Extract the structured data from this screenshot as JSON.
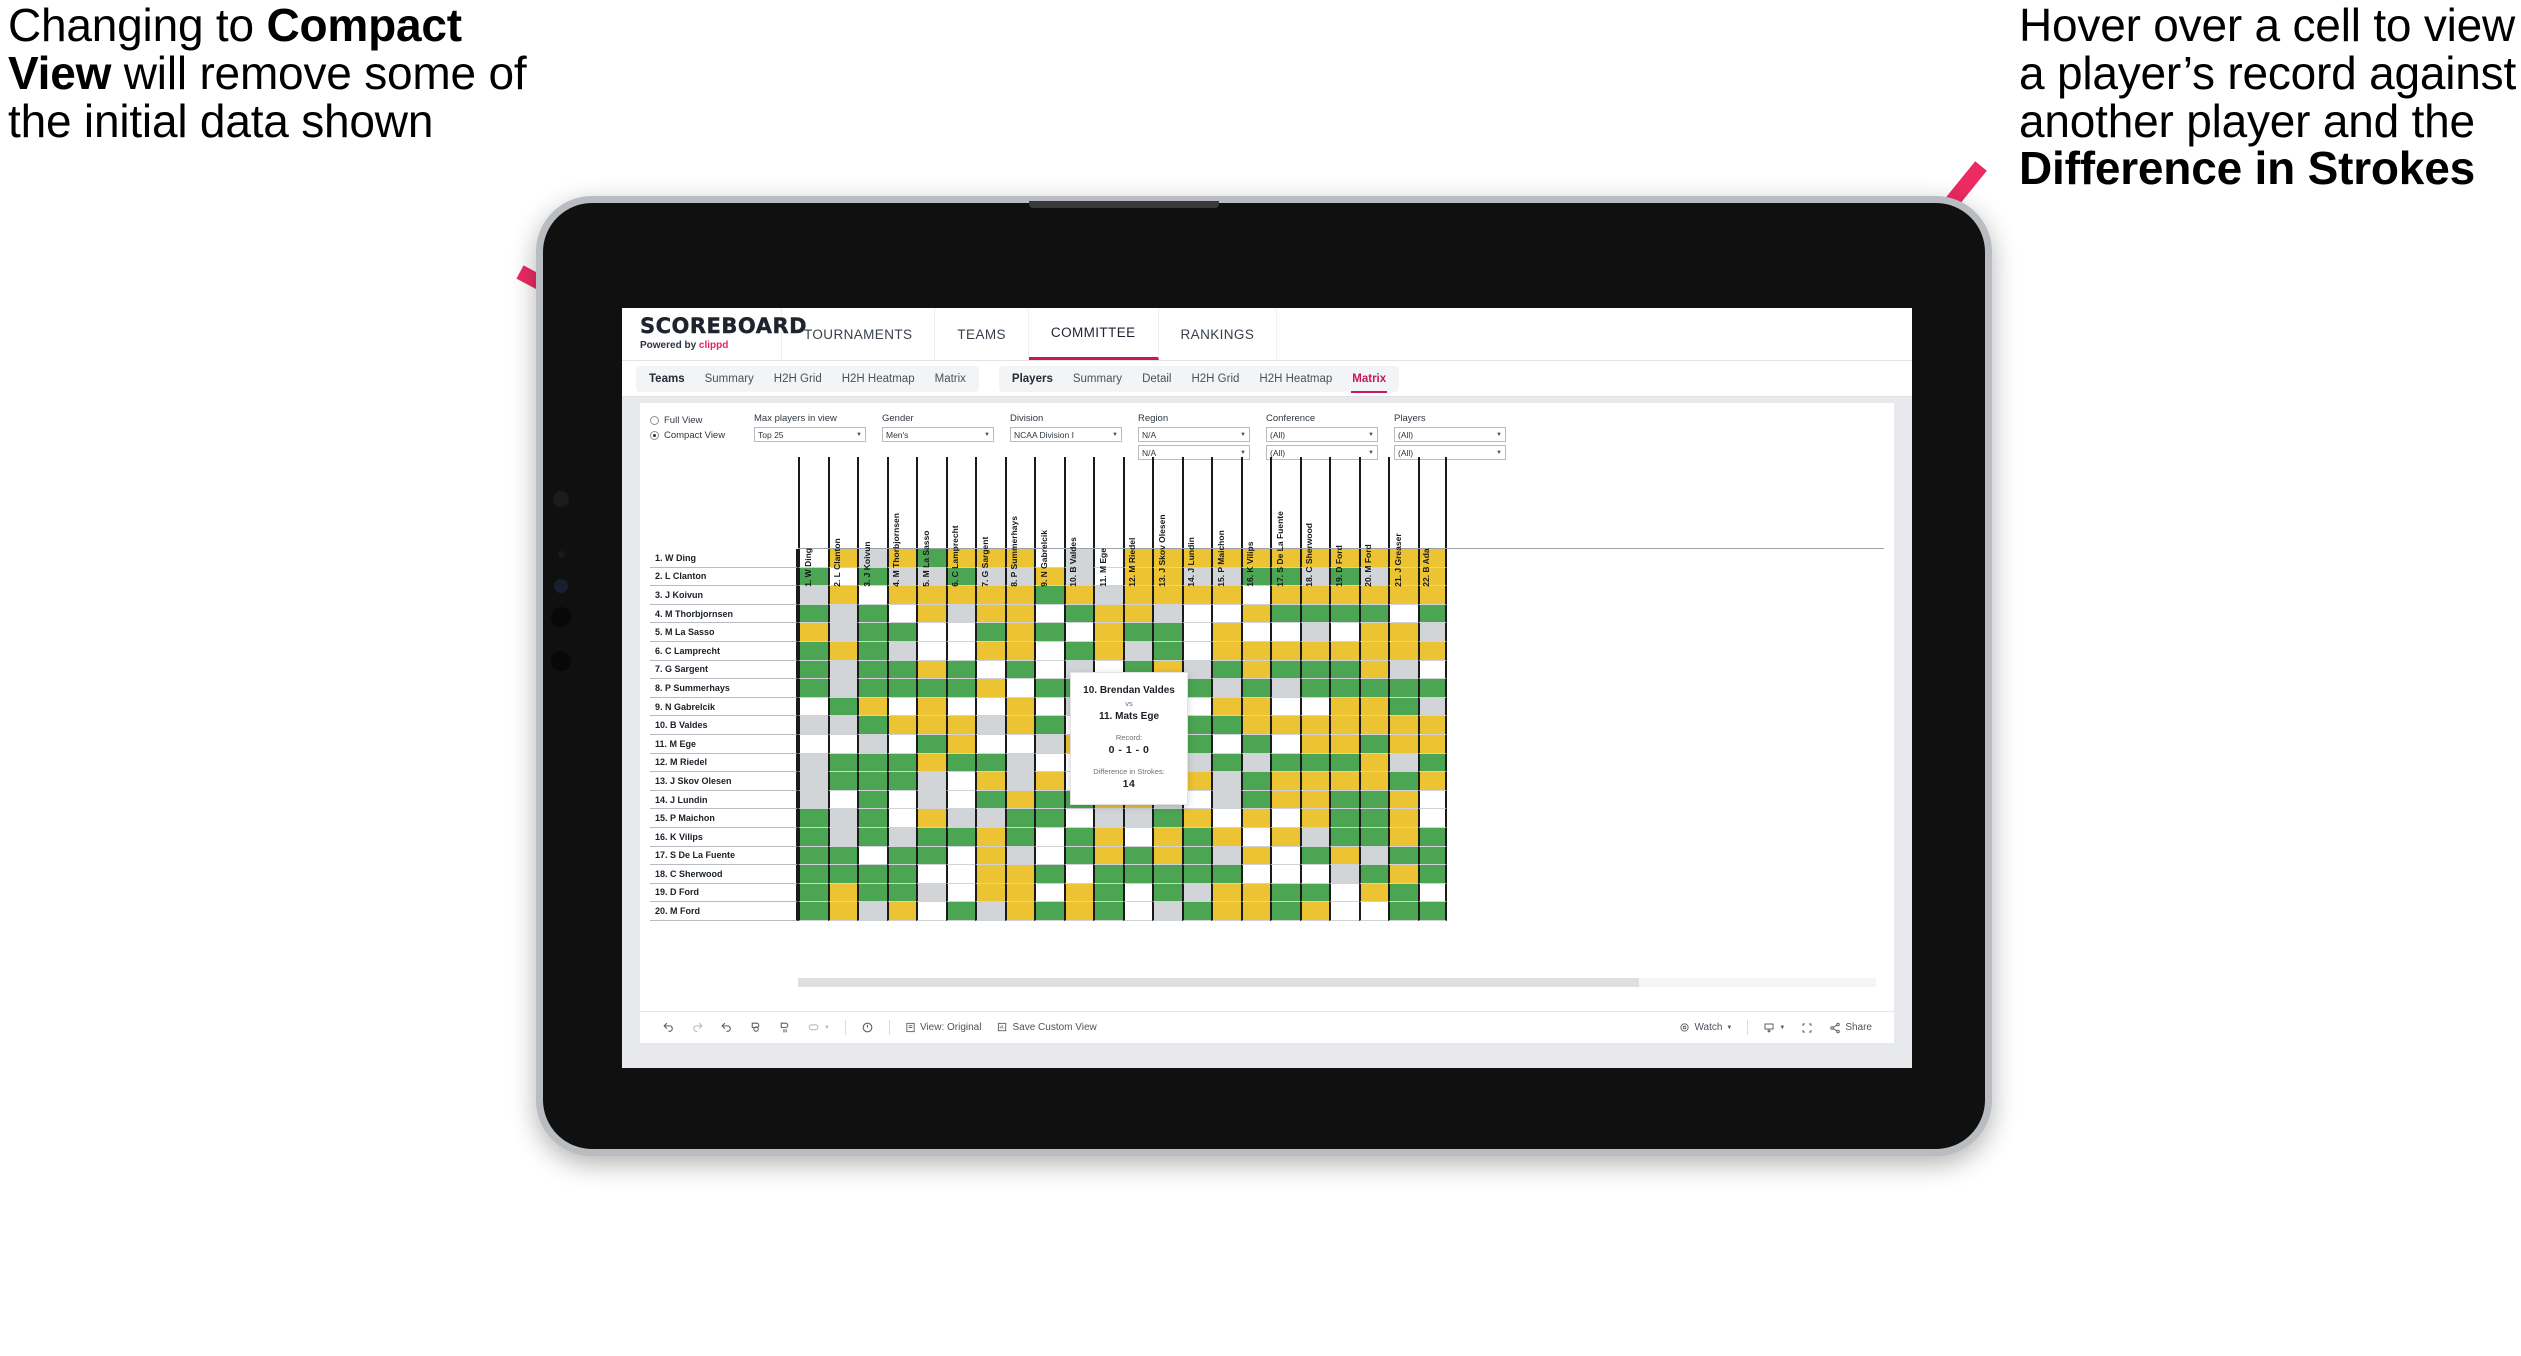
{
  "annotations": {
    "left": {
      "lines": [
        {
          "t": "Changing to ",
          "b": false
        },
        {
          "t": "Compact View",
          "b": true
        },
        {
          "t": " will remove some of the initial data shown",
          "b": false
        }
      ],
      "plain": "Changing to Compact View will remove some of the initial data shown"
    },
    "right": {
      "plain": "Hover over a cell to view a player’s record against another player and the Difference in Strokes",
      "bold_part": "Difference in Strokes"
    },
    "arrow_color": "#ec2a63"
  },
  "brand": {
    "logo": "SCOREBOARD",
    "powered_prefix": "Powered by ",
    "powered_name": "clippd"
  },
  "topnav": {
    "tabs": [
      {
        "label": "TOURNAMENTS",
        "active": false
      },
      {
        "label": "TEAMS",
        "active": false
      },
      {
        "label": "COMMITTEE",
        "active": true
      },
      {
        "label": "RANKINGS",
        "active": false
      }
    ]
  },
  "subnav": {
    "group_teams": [
      {
        "label": "Teams",
        "style": "bold"
      },
      {
        "label": "Summary",
        "style": "normal"
      },
      {
        "label": "H2H Grid",
        "style": "normal"
      },
      {
        "label": "H2H Heatmap",
        "style": "normal"
      },
      {
        "label": "Matrix",
        "style": "normal"
      }
    ],
    "group_players": [
      {
        "label": "Players",
        "style": "bold"
      },
      {
        "label": "Summary",
        "style": "normal"
      },
      {
        "label": "Detail",
        "style": "normal"
      },
      {
        "label": "H2H Grid",
        "style": "normal"
      },
      {
        "label": "H2H Heatmap",
        "style": "normal"
      },
      {
        "label": "Matrix",
        "style": "selected"
      }
    ]
  },
  "filters": {
    "view_modes": [
      {
        "label": "Full View",
        "selected": false
      },
      {
        "label": "Compact View",
        "selected": true
      }
    ],
    "dropdowns": [
      {
        "label": "Max players in view",
        "values": [
          "Top 25"
        ]
      },
      {
        "label": "Gender",
        "values": [
          "Men's"
        ]
      },
      {
        "label": "Division",
        "values": [
          "NCAA Division I"
        ]
      },
      {
        "label": "Region",
        "values": [
          "N/A",
          "N/A"
        ]
      },
      {
        "label": "Conference",
        "values": [
          "(All)",
          "(All)"
        ]
      },
      {
        "label": "Players",
        "values": [
          "(All)",
          "(All)"
        ]
      }
    ]
  },
  "matrix": {
    "columns": [
      "1. W Ding",
      "2. L Clanton",
      "3. J Koivun",
      "4. M Thorbjornsen",
      "5. M La Sasso",
      "6. C Lamprecht",
      "7. G Sargent",
      "8. P Summerhays",
      "9. N Gabrelcik",
      "10. B Valdes",
      "11. M Ege",
      "12. M Riedel",
      "13. J Skov Olesen",
      "14. J Lundin",
      "15. P Maichon",
      "16. K Vilips",
      "17. S De La Fuente",
      "18. C Sherwood",
      "19. D Ford",
      "20. M Ford",
      "21. J Greaser",
      "22. B Ada"
    ],
    "rows": [
      "1. W Ding",
      "2. L Clanton",
      "3. J Koivun",
      "4. M Thorbjornsen",
      "5. M La Sasso",
      "6. C Lamprecht",
      "7. G Sargent",
      "8. P Summerhays",
      "9. N Gabrelcik",
      "10. B Valdes",
      "11. M Ege",
      "12. M Riedel",
      "13. J Skov Olesen",
      "14. J Lundin",
      "15. P Maichon",
      "16. K Vilips",
      "17. S De La Fuente",
      "18. C Sherwood",
      "19. D Ford",
      "20. M Ford"
    ],
    "legend_colors": {
      "win": "#4ca552",
      "loss": "#ecc333",
      "tie": "#d2d5d8",
      "none": "#ffffff"
    },
    "cells": [
      [
        "w",
        "y",
        "a",
        "y",
        "g",
        "y",
        "y",
        "y",
        "w",
        "a",
        "w",
        "y",
        "y",
        "y",
        "y",
        "y",
        "y",
        "y",
        "y",
        "y",
        "y",
        "y"
      ],
      [
        "g",
        "w",
        "g",
        "a",
        "a",
        "g",
        "a",
        "a",
        "y",
        "a",
        "w",
        "y",
        "y",
        "a",
        "a",
        "g",
        "g",
        "a",
        "g",
        "a",
        "y",
        "y"
      ],
      [
        "a",
        "y",
        "w",
        "y",
        "y",
        "y",
        "y",
        "y",
        "g",
        "y",
        "a",
        "y",
        "y",
        "y",
        "y",
        "w",
        "y",
        "y",
        "y",
        "y",
        "y",
        "y"
      ],
      [
        "g",
        "a",
        "g",
        "w",
        "y",
        "a",
        "y",
        "y",
        "w",
        "g",
        "y",
        "y",
        "a",
        "w",
        "w",
        "y",
        "g",
        "g",
        "g",
        "g",
        "w",
        "g"
      ],
      [
        "y",
        "a",
        "g",
        "g",
        "w",
        "w",
        "g",
        "y",
        "g",
        "w",
        "y",
        "g",
        "g",
        "w",
        "y",
        "w",
        "w",
        "a",
        "w",
        "y",
        "y",
        "a"
      ],
      [
        "g",
        "y",
        "g",
        "a",
        "w",
        "w",
        "y",
        "y",
        "w",
        "g",
        "y",
        "a",
        "g",
        "w",
        "y",
        "y",
        "y",
        "y",
        "y",
        "y",
        "y",
        "y"
      ],
      [
        "g",
        "a",
        "g",
        "g",
        "y",
        "g",
        "w",
        "g",
        "w",
        "a",
        "w",
        "g",
        "y",
        "a",
        "g",
        "y",
        "g",
        "g",
        "g",
        "y",
        "a",
        "w"
      ],
      [
        "g",
        "a",
        "g",
        "g",
        "g",
        "g",
        "y",
        "w",
        "g",
        "g",
        "w",
        "a",
        "a",
        "g",
        "a",
        "g",
        "a",
        "g",
        "g",
        "g",
        "g",
        "g"
      ],
      [
        "w",
        "g",
        "y",
        "w",
        "y",
        "w",
        "w",
        "y",
        "w",
        "a",
        "w",
        "g",
        "w",
        "w",
        "y",
        "y",
        "w",
        "w",
        "y",
        "y",
        "g",
        "a"
      ],
      [
        "a",
        "a",
        "g",
        "y",
        "y",
        "y",
        "a",
        "y",
        "g",
        "w",
        "w",
        "y",
        "a",
        "g",
        "g",
        "y",
        "y",
        "y",
        "y",
        "y",
        "y",
        "y"
      ],
      [
        "w",
        "w",
        "a",
        "w",
        "g",
        "y",
        "w",
        "w",
        "a",
        "y",
        "w",
        "w",
        "w",
        "g",
        "w",
        "g",
        "w",
        "y",
        "y",
        "g",
        "y",
        "y"
      ],
      [
        "a",
        "g",
        "g",
        "g",
        "y",
        "g",
        "g",
        "a",
        "w",
        "w",
        "y",
        "w",
        "g",
        "a",
        "g",
        "a",
        "g",
        "g",
        "g",
        "y",
        "a",
        "g"
      ],
      [
        "a",
        "g",
        "g",
        "g",
        "a",
        "w",
        "y",
        "a",
        "y",
        "w",
        "g",
        "y",
        "w",
        "y",
        "a",
        "g",
        "y",
        "y",
        "y",
        "y",
        "g",
        "y"
      ],
      [
        "a",
        "w",
        "g",
        "w",
        "a",
        "w",
        "g",
        "y",
        "g",
        "g",
        "y",
        "y",
        "a",
        "w",
        "a",
        "g",
        "y",
        "y",
        "g",
        "g",
        "y",
        "w"
      ],
      [
        "g",
        "a",
        "g",
        "w",
        "y",
        "a",
        "a",
        "g",
        "g",
        "w",
        "a",
        "a",
        "g",
        "y",
        "w",
        "y",
        "w",
        "y",
        "g",
        "g",
        "y",
        "w"
      ],
      [
        "g",
        "a",
        "g",
        "a",
        "g",
        "g",
        "y",
        "g",
        "w",
        "g",
        "y",
        "w",
        "y",
        "g",
        "y",
        "w",
        "y",
        "a",
        "g",
        "g",
        "y",
        "g"
      ],
      [
        "g",
        "g",
        "w",
        "g",
        "g",
        "w",
        "y",
        "a",
        "w",
        "g",
        "y",
        "g",
        "y",
        "g",
        "a",
        "y",
        "w",
        "g",
        "y",
        "a",
        "g",
        "g"
      ],
      [
        "g",
        "g",
        "g",
        "g",
        "w",
        "w",
        "y",
        "y",
        "g",
        "w",
        "g",
        "g",
        "g",
        "g",
        "g",
        "w",
        "w",
        "w",
        "a",
        "g",
        "y",
        "g"
      ],
      [
        "g",
        "y",
        "g",
        "g",
        "a",
        "w",
        "y",
        "y",
        "w",
        "y",
        "g",
        "w",
        "g",
        "a",
        "y",
        "y",
        "g",
        "g",
        "w",
        "y",
        "g",
        "w"
      ],
      [
        "g",
        "y",
        "a",
        "y",
        "w",
        "g",
        "a",
        "y",
        "g",
        "y",
        "g",
        "w",
        "a",
        "g",
        "y",
        "y",
        "g",
        "y",
        "w",
        "w",
        "g",
        "g"
      ]
    ]
  },
  "tooltip": {
    "player_a": "10. Brendan Valdes",
    "vs": "vs",
    "player_b": "11. Mats Ege",
    "record_label": "Record:",
    "record_value": "0 - 1 - 0",
    "diff_label": "Difference in Strokes:",
    "diff_value": "14"
  },
  "bottombar": {
    "left_icons": [
      "undo-icon",
      "redo-icon",
      "revert-icon",
      "refresh-icon",
      "pause-icon",
      "highlight-icon"
    ],
    "items": [
      {
        "name": "view-original",
        "label": "View: Original",
        "icon": "view-icon"
      },
      {
        "name": "save-custom-view",
        "label": "Save Custom View",
        "icon": "save-view-icon"
      }
    ],
    "watch": {
      "label": "Watch",
      "icon": "watch-icon"
    },
    "download": {
      "label": "",
      "icon": "download-icon"
    },
    "fullscreen": {
      "label": "",
      "icon": "fullscreen-icon"
    },
    "share": {
      "label": "Share",
      "icon": "share-icon"
    }
  }
}
